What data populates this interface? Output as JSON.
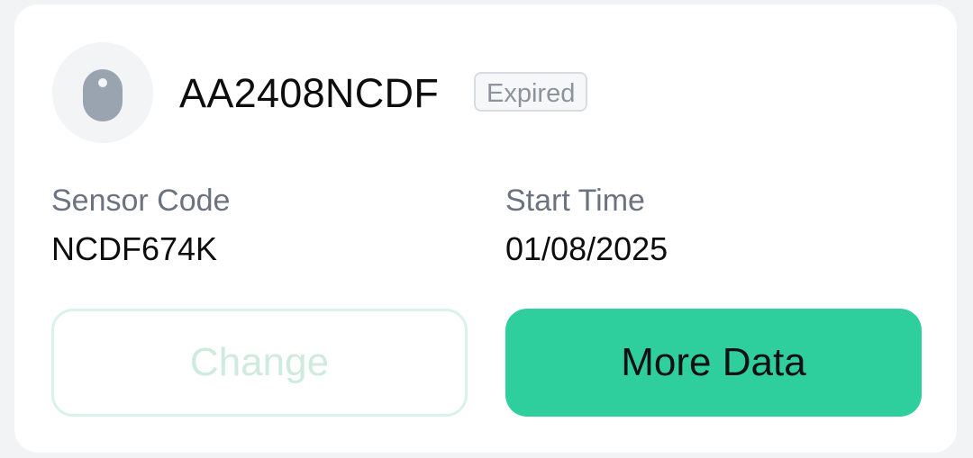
{
  "device": {
    "id": "AA2408NCDF",
    "status": "Expired"
  },
  "info": {
    "sensor_code_label": "Sensor Code",
    "sensor_code_value": "NCDF674K",
    "start_time_label": "Start Time",
    "start_time_value": "01/08/2025"
  },
  "buttons": {
    "change_label": "Change",
    "more_data_label": "More Data"
  },
  "icons": {
    "sensor": "sensor-icon"
  },
  "colors": {
    "accent": "#2ecf9c",
    "badge_text": "#8c939c",
    "label_text": "#6b7280"
  }
}
